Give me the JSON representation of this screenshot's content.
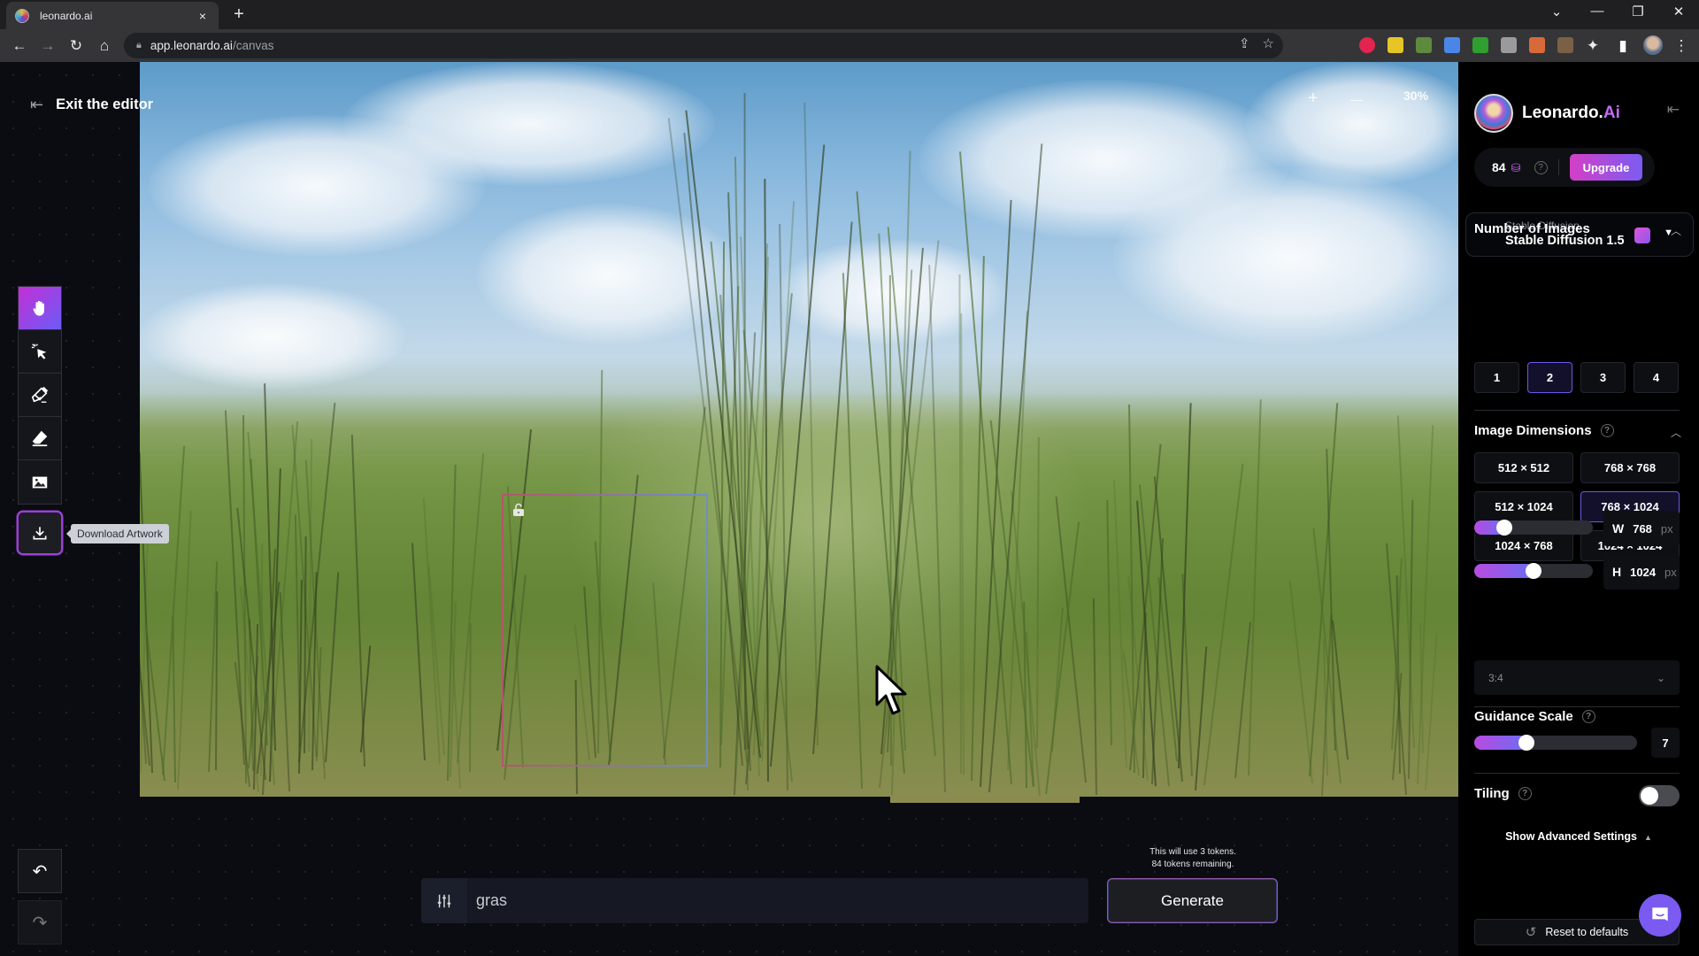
{
  "browser": {
    "tab_title": "leonardo.ai",
    "tab_close": "×",
    "new_tab": "+",
    "url_host": "app.leonardo.ai",
    "url_path": "/canvas",
    "window_controls": {
      "dropdown": "⌄",
      "minimize": "—",
      "restore": "❐",
      "close": "✕"
    },
    "extensions": [
      {
        "name": "adblock-plus",
        "color": "#e2244e"
      },
      {
        "name": "yellow-extension",
        "color": "#e6c627"
      },
      {
        "name": "rainbow-extension",
        "color": "#5d8a3c"
      },
      {
        "name": "blue-extension",
        "color": "#4a86e8"
      },
      {
        "name": "download-extension",
        "color": "#2fa02f"
      },
      {
        "name": "camera-extension",
        "color": "#9a9a9a"
      },
      {
        "name": "color-extension",
        "color": "#d86a3a"
      },
      {
        "name": "brown-extension",
        "color": "#7a6045"
      }
    ]
  },
  "editor": {
    "exit_label": "Exit the editor",
    "zoom_in": "+",
    "zoom_out": "—",
    "zoom_level": "30%",
    "tools": [
      {
        "name": "pan-tool",
        "active": true
      },
      {
        "name": "select-tool",
        "active": false
      },
      {
        "name": "draw-mask-tool",
        "active": false
      },
      {
        "name": "erase-tool",
        "active": false
      },
      {
        "name": "image-upload-tool",
        "active": false
      }
    ],
    "download_tooltip": "Download Artwork",
    "undo": "↶",
    "redo": "↷"
  },
  "prompt": {
    "value": "gras",
    "token_line1": "This will use 3 tokens.",
    "token_line2": "84 tokens remaining.",
    "generate_label": "Generate"
  },
  "panel": {
    "brand_name": "Leonardo.",
    "brand_suffix": "Ai",
    "credits": "84",
    "upgrade_label": "Upgrade",
    "model_category": "Stable Diffusion",
    "model_name": "Stable Diffusion 1.5",
    "num_images_title": "Number of Images",
    "num_images_options": [
      "1",
      "2",
      "3",
      "4"
    ],
    "num_images_selected": "2",
    "dimensions_title": "Image Dimensions",
    "dimension_options": [
      "512 × 512",
      "768 × 768",
      "512 × 1024",
      "768 × 1024",
      "1024 × 768",
      "1024 × 1024"
    ],
    "dimension_selected": "768 × 1024",
    "width_label": "W",
    "width_value": "768",
    "height_label": "H",
    "height_value": "1024",
    "unit": "px",
    "width_slider_fraction": 0.25,
    "height_slider_fraction": 0.5,
    "aspect_ratio": "3:4",
    "guidance_title": "Guidance Scale",
    "guidance_value": "7",
    "guidance_slider_fraction": 0.32,
    "tiling_title": "Tiling",
    "tiling_on": false,
    "advanced_label": "Show Advanced Settings",
    "reset_label": "Reset to defaults"
  },
  "colors": {
    "accent_start": "#c32fd6",
    "accent_end": "#6b5cf6",
    "selected_border": "#6a5ae6",
    "chat_button": "#7a5af0"
  }
}
